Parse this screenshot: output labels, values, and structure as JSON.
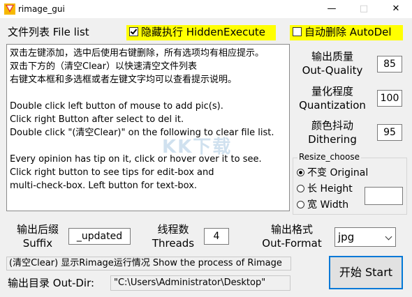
{
  "window": {
    "title": "rimage_gui",
    "minimize_icon": "minimize-icon",
    "maximize_icon": "maximize-icon",
    "close_icon": "close-icon"
  },
  "file_list": {
    "label": "文件列表 File list",
    "lines": [
      "双击左键添加，选中后使用右键删除，所有选项均有相应提示。",
      "双击下方的（清空Clear）以快速清空文件列表",
      "右键文本框和多选框或者左键文字均可以查看提示说明。",
      "",
      "Double click left button of mouse to add pic(s).",
      "Click right Button after select to del it.",
      "Double click \"(清空Clear)\" on the following to clear file list.",
      "",
      "Every opinion has tip on it, click or hover over it to see.",
      "Click right button to see tips for edit-box and",
      "multi-check-box. Left button for text-box."
    ]
  },
  "options": {
    "hidden_execute": {
      "label": "隐藏执行 HiddenExecute",
      "checked": true
    },
    "auto_delete": {
      "label": "自动删除 AutoDel",
      "checked": false
    }
  },
  "quality": {
    "label_cn": "输出质量",
    "label_en": "Out-Quality",
    "value": "85"
  },
  "quantization": {
    "label_cn": "量化程度",
    "label_en": "Quantization",
    "value": "100"
  },
  "dithering": {
    "label_cn": "颜色抖动",
    "label_en": "Dithering",
    "value": "95"
  },
  "resize": {
    "legend": "Resize_choose",
    "options": [
      {
        "label": "不变 Original",
        "selected": true
      },
      {
        "label": "长 Height",
        "selected": false
      },
      {
        "label": "宽 Width",
        "selected": false
      }
    ],
    "value": ""
  },
  "suffix": {
    "label_cn": "输出后缀",
    "label_en": "Suffix",
    "value": "_updated"
  },
  "threads": {
    "label_cn": "线程数",
    "label_en": "Threads",
    "value": "4"
  },
  "format": {
    "label_cn": "输出格式",
    "label_en": "Out-Format",
    "selected": "jpg"
  },
  "status": {
    "text": "(清空Clear) 显示Rimage运行情况 Show the process of Rimage"
  },
  "output_dir": {
    "label": "输出目录 Out-Dir:",
    "value": "\"C:\\Users\\Administrator\\Desktop\""
  },
  "start": {
    "label": "开始 Start"
  },
  "watermark": "KK下载"
}
